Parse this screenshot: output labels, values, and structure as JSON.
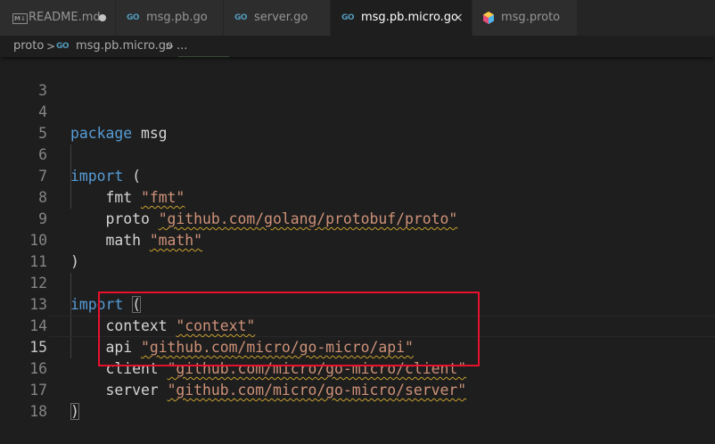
{
  "tabs": [
    {
      "label": "README.md",
      "icon": "markdown-icon",
      "icon_text": "M↓",
      "modified": true
    },
    {
      "label": "msg.pb.go",
      "icon": "go-icon",
      "icon_text": "GO"
    },
    {
      "label": "server.go",
      "icon": "go-icon",
      "icon_text": "GO"
    },
    {
      "label": "msg.pb.micro.go",
      "icon": "go-icon",
      "icon_text": "GO",
      "active": true,
      "close": "×"
    },
    {
      "label": "msg.proto",
      "icon": "protobuf-icon"
    }
  ],
  "breadcrumb": {
    "folder": "proto",
    "sep": ">",
    "file_icon": "GO",
    "file": "msg.pb.micro.go",
    "ellipsis": "..."
  },
  "editor": {
    "current_line": 15,
    "lines": [
      {
        "n": "3",
        "text": ""
      },
      {
        "n": "4",
        "text": "package msg"
      },
      {
        "n": "5",
        "text": ""
      },
      {
        "n": "6",
        "text": "import ("
      },
      {
        "n": "7",
        "text": "    fmt \"fmt\""
      },
      {
        "n": "8",
        "text": "    proto \"github.com/golang/protobuf/proto\""
      },
      {
        "n": "9",
        "text": "    math \"math\""
      },
      {
        "n": "10",
        "text": ")"
      },
      {
        "n": "11",
        "text": ""
      },
      {
        "n": "12",
        "text": "import ("
      },
      {
        "n": "13",
        "text": "    context \"context\""
      },
      {
        "n": "14",
        "text": "    api \"github.com/micro/go-micro/api\""
      },
      {
        "n": "15",
        "text": "    client \"github.com/micro/go-micro/client\""
      },
      {
        "n": "16",
        "text": "    server \"github.com/micro/go-micro/server\""
      },
      {
        "n": "17",
        "text": ")"
      },
      {
        "n": "18",
        "text": ""
      }
    ]
  },
  "code_parts": {
    "package_kw": "package",
    "package_name": " msg",
    "import_kw": "import",
    "open_paren": " (",
    "space": " ",
    "paren_open": "(",
    "close_paren": ")",
    "fmt_id": "    fmt ",
    "fmt_str": "\"fmt\"",
    "proto_id": "    proto ",
    "proto_str": "\"github.com/golang/protobuf/proto\"",
    "math_id": "    math ",
    "math_str": "\"math\"",
    "context_id": "    context ",
    "context_str": "\"context\"",
    "api_id": "    api ",
    "api_str": "\"github.com/micro/go-micro/api\"",
    "client_id": "    client ",
    "client_str": "\"github.com/micro/go-micro/client\"",
    "server_id": "    server ",
    "server_str": "\"github.com/micro/go-micro/server\""
  },
  "colors": {
    "keyword": "#569cd6",
    "string": "#ce9178",
    "identifier": "#d4d4d4",
    "highlight_box": "#e8112d"
  }
}
